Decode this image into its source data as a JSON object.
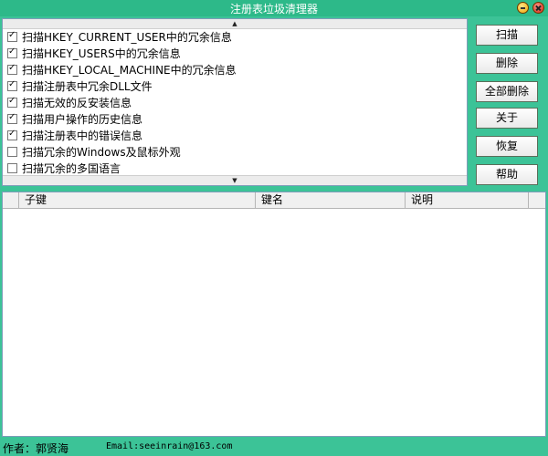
{
  "window": {
    "title": "注册表垃圾清理器",
    "minimize_icon": "minimize-icon",
    "close_icon": "close-icon"
  },
  "options": [
    {
      "label": "扫描HKEY_CURRENT_USER中的冗余信息",
      "checked": true
    },
    {
      "label": "扫描HKEY_USERS中的冗余信息",
      "checked": true
    },
    {
      "label": "扫描HKEY_LOCAL_MACHINE中的冗余信息",
      "checked": true
    },
    {
      "label": "扫描注册表中冗余DLL文件",
      "checked": true
    },
    {
      "label": "扫描无效的反安装信息",
      "checked": true
    },
    {
      "label": "扫描用户操作的历史信息",
      "checked": true
    },
    {
      "label": "扫描注册表中的错误信息",
      "checked": true
    },
    {
      "label": "扫描冗余的Windows及鼠标外观",
      "checked": false
    },
    {
      "label": "扫描冗余的多国语言",
      "checked": false
    }
  ],
  "scroll": {
    "up_glyph": "▲",
    "down_glyph": "▼"
  },
  "buttons": {
    "scan": "扫描",
    "delete": "删除",
    "delete_all": "全部删除",
    "about": "关于",
    "restore": "恢复",
    "help": "帮助"
  },
  "list": {
    "columns": [
      "子键",
      "键名",
      "说明"
    ]
  },
  "status": {
    "author": "作者：郭贤海",
    "email": "Email:seeinrain@163.com"
  },
  "colors": {
    "background": "#3cc397",
    "titlebar": "#2db989"
  }
}
